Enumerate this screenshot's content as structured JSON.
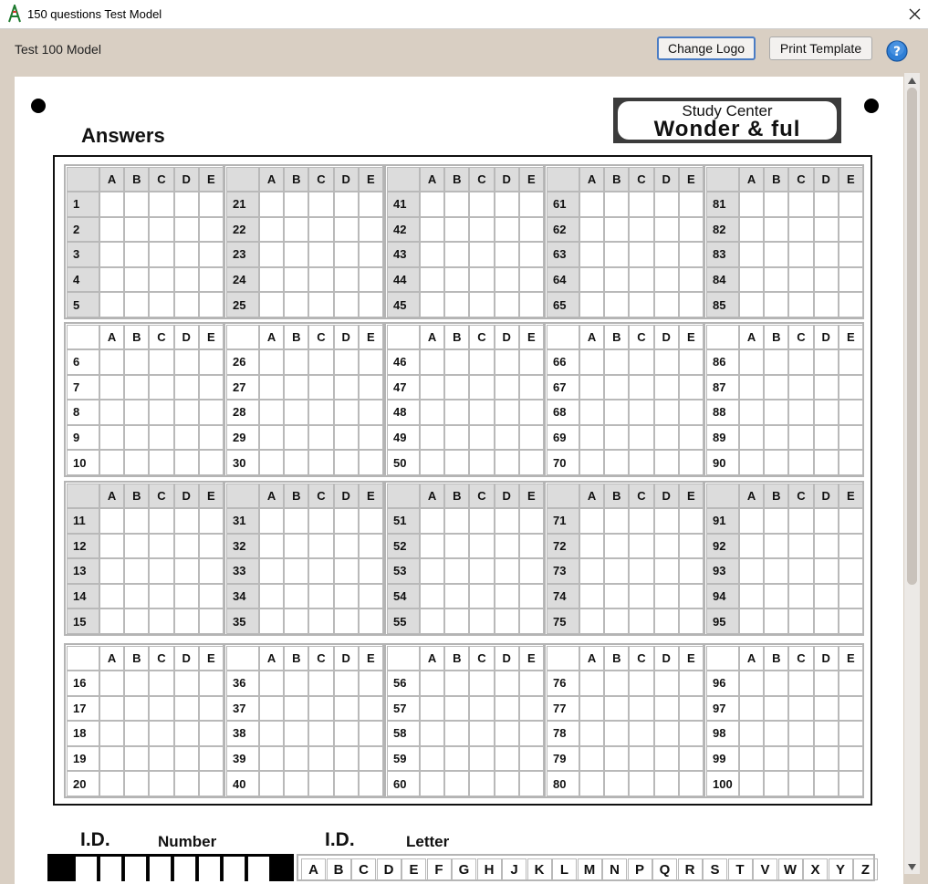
{
  "window": {
    "title": "150 questions Test Model",
    "close_glyph": "✕",
    "app_icon": "app-logo-icon"
  },
  "toolbar": {
    "model_name": "Test 100 Model",
    "change_logo_label": "Change Logo",
    "print_template_label": "Print Template",
    "help_icon": "help-icon",
    "help_glyph": "?"
  },
  "sheet": {
    "title": "Answers",
    "logo": {
      "line1": "Study Center",
      "line2": "Wonder & ful"
    },
    "options": [
      "A",
      "B",
      "C",
      "D",
      "E"
    ],
    "bands": [
      {
        "shaded": true,
        "columns": [
          [
            1,
            2,
            3,
            4,
            5
          ],
          [
            21,
            22,
            23,
            24,
            25
          ],
          [
            41,
            42,
            43,
            44,
            45
          ],
          [
            61,
            62,
            63,
            64,
            65
          ],
          [
            81,
            82,
            83,
            84,
            85
          ]
        ]
      },
      {
        "shaded": false,
        "columns": [
          [
            6,
            7,
            8,
            9,
            10
          ],
          [
            26,
            27,
            28,
            29,
            30
          ],
          [
            46,
            47,
            48,
            49,
            50
          ],
          [
            66,
            67,
            68,
            69,
            70
          ],
          [
            86,
            87,
            88,
            89,
            90
          ]
        ]
      },
      {
        "shaded": true,
        "columns": [
          [
            11,
            12,
            13,
            14,
            15
          ],
          [
            31,
            32,
            33,
            34,
            35
          ],
          [
            51,
            52,
            53,
            54,
            55
          ],
          [
            71,
            72,
            73,
            74,
            75
          ],
          [
            91,
            92,
            93,
            94,
            95
          ]
        ]
      },
      {
        "shaded": false,
        "columns": [
          [
            16,
            17,
            18,
            19,
            20
          ],
          [
            36,
            37,
            38,
            39,
            40
          ],
          [
            56,
            57,
            58,
            59,
            60
          ],
          [
            76,
            77,
            78,
            79,
            80
          ],
          [
            96,
            97,
            98,
            99,
            100
          ]
        ]
      }
    ],
    "id_number": {
      "label": "I.D.",
      "sublabel": "Number"
    },
    "id_letter": {
      "label": "I.D.",
      "sublabel": "Letter",
      "letters": [
        "A",
        "B",
        "C",
        "D",
        "E",
        "F",
        "G",
        "H",
        "J",
        "K",
        "L",
        "M",
        "N",
        "P",
        "Q",
        "R",
        "S",
        "T",
        "V",
        "W",
        "X",
        "Y",
        "Z"
      ]
    }
  },
  "colors": {
    "chrome": "#d9cfc3",
    "shade": "#dcdcdc",
    "accent": "#4a7cc4",
    "help": "#2f7fd6"
  }
}
